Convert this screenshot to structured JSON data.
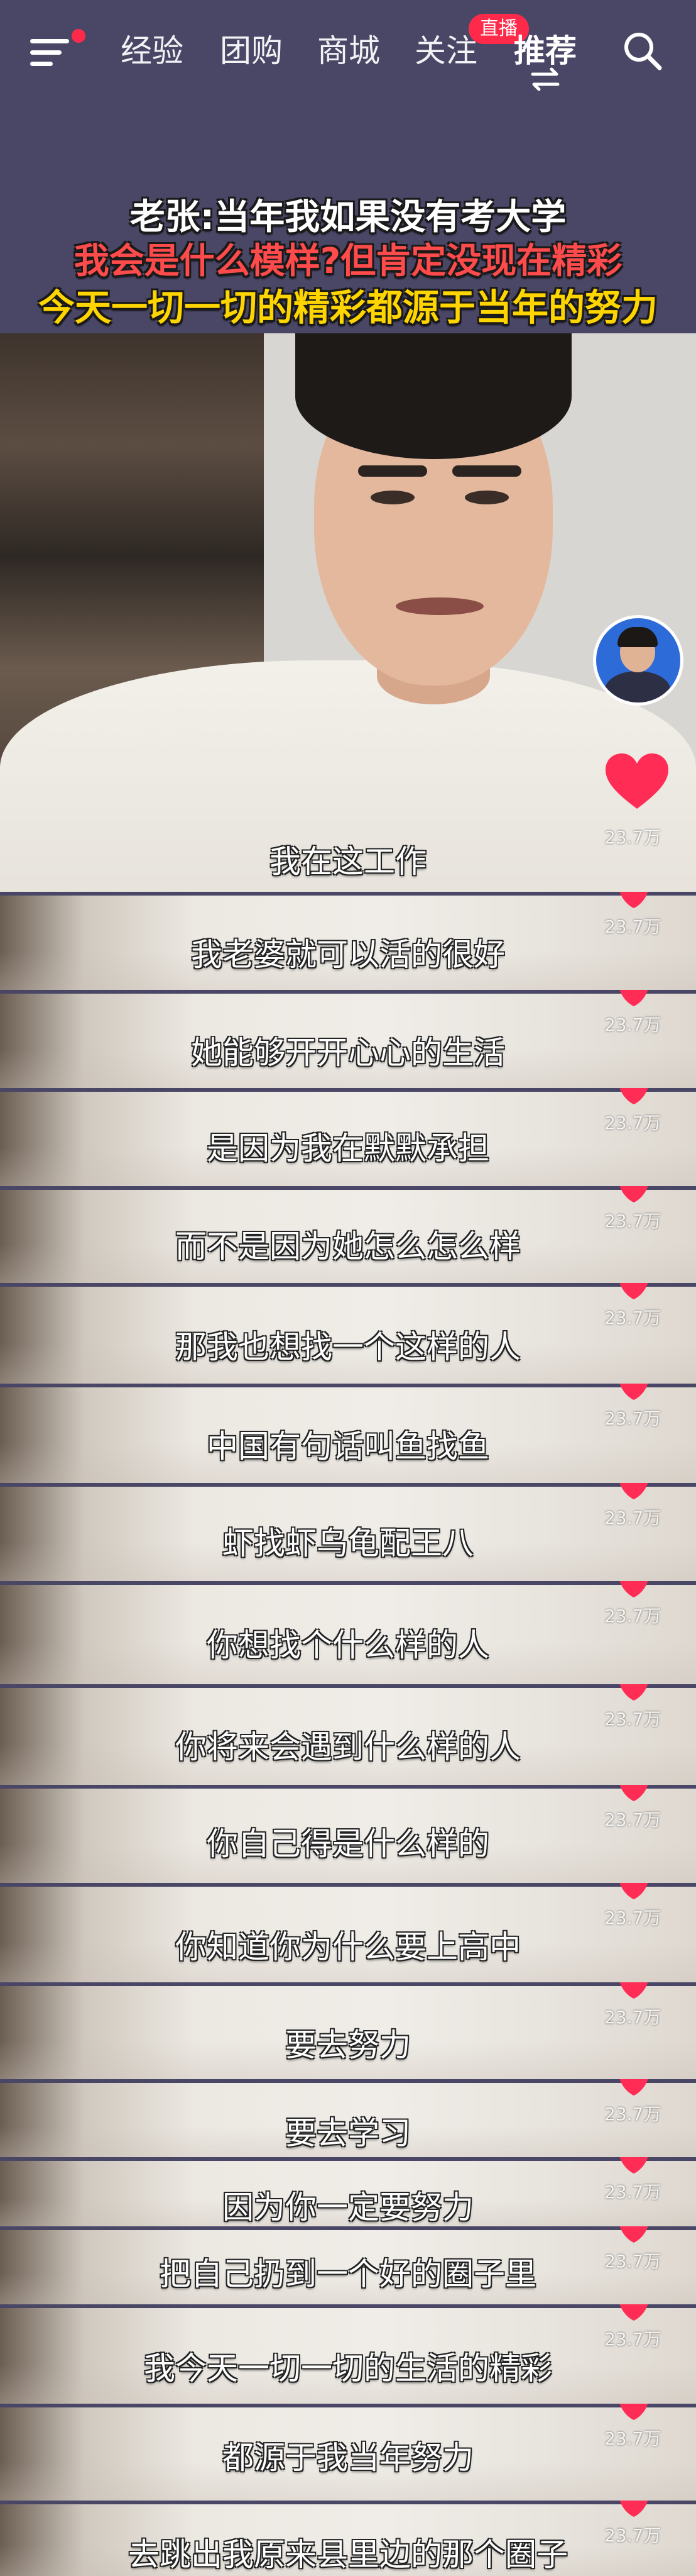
{
  "nav": {
    "tabs": [
      "经验",
      "团购",
      "商城",
      "关注",
      "推荐"
    ],
    "live_badge": "直播",
    "active_tab": "推荐"
  },
  "title": {
    "line1": "老张:当年我如果没有考大学",
    "line2": "我会是什么模样?但肯定没现在精彩",
    "line3": "今天一切一切的精彩都源于当年的努力"
  },
  "colors": {
    "nav_bg": "#4a4766",
    "accent_red": "#ff2a4a",
    "title_white": "#ffffff",
    "title_red": "#ff4b4b",
    "title_yellow": "#ffd500"
  },
  "likes": "23.7万",
  "subtitles": [
    "我在这工作",
    "我老婆就可以活的很好",
    "她能够开开心心的生活",
    "是因为我在默默承担",
    "而不是因为她怎么怎么样",
    "那我也想找一个这样的人",
    "中国有句话叫鱼找鱼",
    "虾找虾乌龟配王八",
    "你想找个什么样的人",
    "你将来会遇到什么样的人",
    "你自己得是什么样的",
    "你知道你为什么要上高中",
    "要去努力",
    "要去学习",
    "因为你一定要努力",
    "把自己扔到一个好的圈子里",
    "我今天一切一切的生活的精彩",
    "都源于我当年努力",
    "去跳出我原来县里边的那个圈子"
  ],
  "icons": [
    "menu-icon",
    "notification-dot",
    "swap-icon",
    "search-icon",
    "heart-icon",
    "creator-avatar"
  ]
}
